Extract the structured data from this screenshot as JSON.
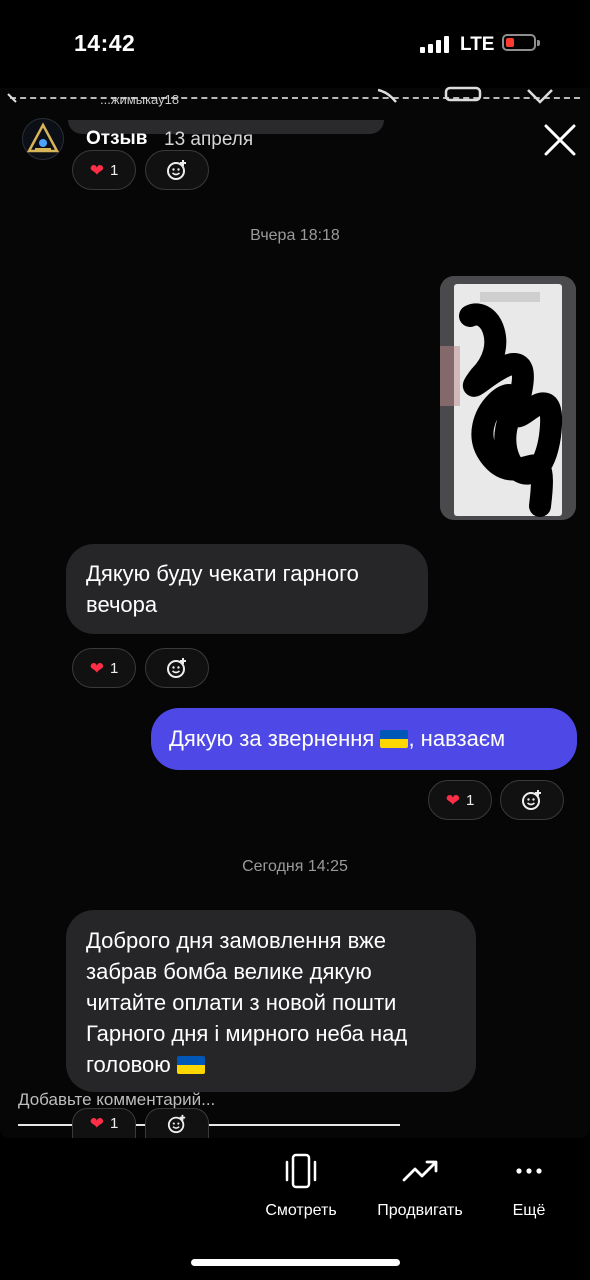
{
  "status_bar": {
    "time": "14:42",
    "network": "LTE",
    "battery_color": "#ff3b30"
  },
  "story": {
    "title": "Отзыв",
    "date": "13 апреля",
    "header_fragment": "...жимыкау18"
  },
  "messages": [
    {
      "id": "top-reaction",
      "reaction_count": "1"
    },
    {
      "id": "stamp-yesterday",
      "text": "Вчера 18:18"
    },
    {
      "id": "msg-1",
      "side": "incoming",
      "lines": [
        "Дякую буду чекати гарного",
        "вечора"
      ],
      "reaction_count": "1"
    },
    {
      "id": "msg-2",
      "side": "outgoing",
      "text_before_flag": "Дякую за звернення",
      "text_after_flag": ", навзаєм",
      "reaction_count": "1"
    },
    {
      "id": "stamp-today",
      "text": "Сегодня 14:25"
    },
    {
      "id": "msg-3",
      "side": "incoming",
      "lines": [
        "Доброго дня замовлення вже",
        "забрав бомба велике дякую",
        "читайте оплати з новой пошти",
        "Гарного дня і мирного неба над",
        "головою"
      ],
      "reaction_count": "1"
    }
  ],
  "comment": {
    "placeholder": "Добавьте комментарий..."
  },
  "bottom_bar": {
    "view_label": "Смотреть",
    "promote_label": "Продвигать",
    "more_label": "Ещё"
  },
  "colors": {
    "outgoing_bubble": "#4e49e6",
    "incoming_bubble": "#262629",
    "heart": "#ff2d48",
    "flag_blue": "#0057b7",
    "flag_yellow": "#ffd700"
  }
}
